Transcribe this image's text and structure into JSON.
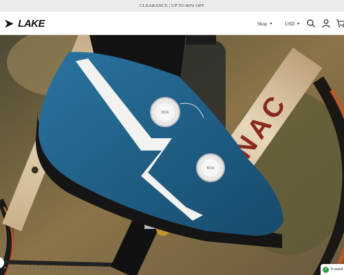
{
  "announcement": {
    "text": "CLEARANCE | UP TO 80% OFF"
  },
  "brand": {
    "logo_text": "LAKE"
  },
  "nav": {
    "shop_label": "Shop",
    "currency_label": "USD"
  },
  "icons": {
    "search": "search-icon",
    "account": "account-icon",
    "cart": "cart-icon"
  },
  "hero": {
    "frame_lettering": "OLNAC",
    "dial_text": "BOA",
    "colors": {
      "shoe": "#1f5f86",
      "stripe": "#f2f2f0",
      "frame": "#d8c4a4",
      "frame_letters": "#8a2a1e"
    }
  },
  "trust_badge": {
    "label": "Trusted"
  }
}
